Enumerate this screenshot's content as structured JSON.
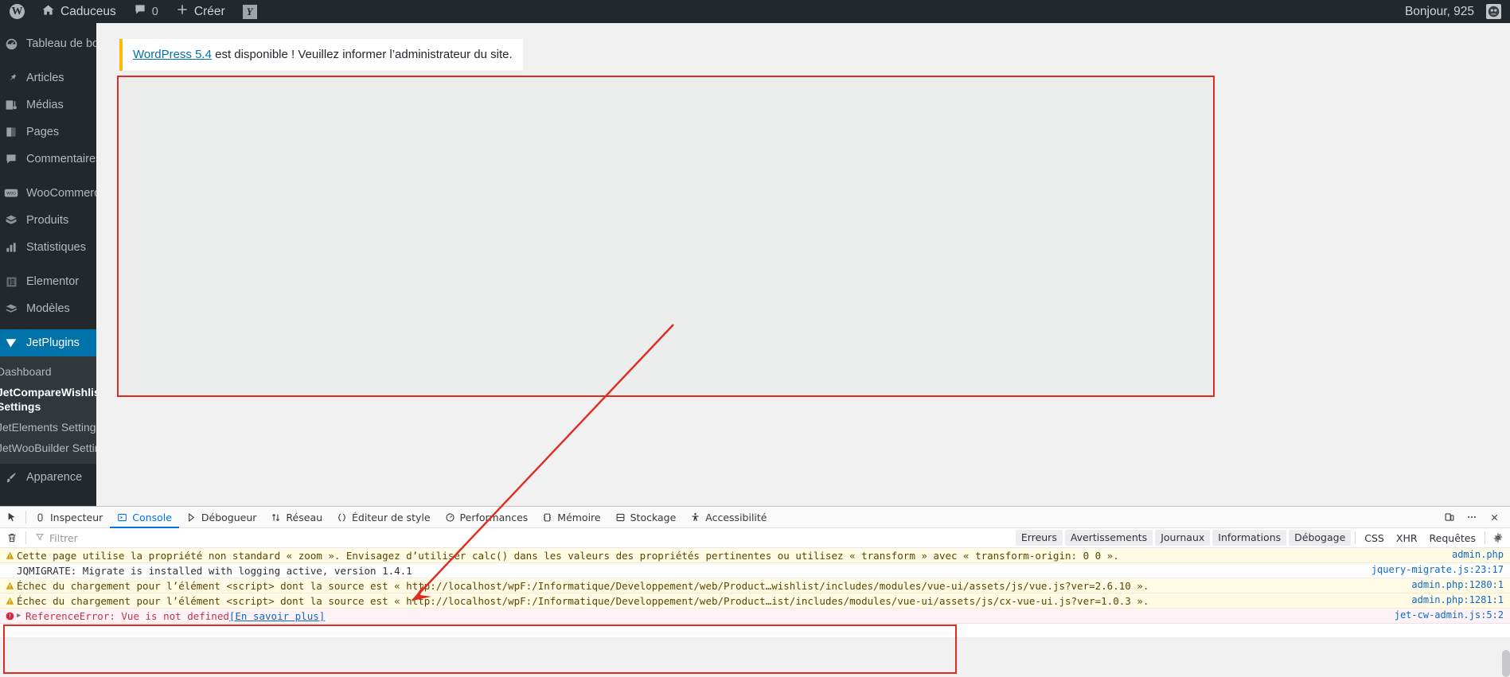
{
  "adminbar": {
    "logo_icon": "wordpress-logo-icon",
    "site_name": "Caduceus",
    "home_icon": "home-icon",
    "comments_icon": "comment-bubble-icon",
    "comments_count": "0",
    "new_icon": "plus-icon",
    "new_label": "Créer",
    "yoast_icon": "yoast-seo-icon",
    "howdy": "Bonjour, 925",
    "avatar_icon": "user-avatar-icon"
  },
  "sidebar": {
    "items": [
      {
        "label": "Tableau de bord",
        "icon": "dashboard-icon",
        "current": false
      },
      {
        "label": "Articles",
        "icon": "pin-icon",
        "current": false
      },
      {
        "label": "Médias",
        "icon": "media-icon",
        "current": false
      },
      {
        "label": "Pages",
        "icon": "page-icon",
        "current": false
      },
      {
        "label": "Commentaires",
        "icon": "comment-bubble-icon",
        "current": false
      },
      {
        "label": "WooCommerce",
        "icon": "woocommerce-icon",
        "current": false
      },
      {
        "label": "Produits",
        "icon": "box-icon",
        "current": false
      },
      {
        "label": "Statistiques",
        "icon": "bar-chart-icon",
        "current": false
      },
      {
        "label": "Elementor",
        "icon": "elementor-icon",
        "current": false
      },
      {
        "label": "Modèles",
        "icon": "template-icon",
        "current": false
      },
      {
        "label": "JetPlugins",
        "icon": "jetplugins-icon",
        "current": true
      }
    ],
    "submenu": [
      {
        "label": "Dashboard",
        "bold": false
      },
      {
        "label": "JetCompareWishlist Settings",
        "bold": true
      },
      {
        "label": "JetElements Settings",
        "bold": false
      },
      {
        "label": "JetWooBuilder Settings",
        "bold": false
      }
    ],
    "after_submenu": [
      {
        "label": "Apparence",
        "icon": "brush-icon",
        "current": false
      }
    ]
  },
  "content": {
    "notice": {
      "link_text": "WordPress 5.4",
      "rest_text": " est disponible ! Veuillez informer l’administrateur du site."
    }
  },
  "devtools": {
    "picker_icon": "element-picker-icon",
    "tabs": [
      {
        "label": "Inspecteur",
        "icon": "inspector-icon",
        "active": false
      },
      {
        "label": "Console",
        "icon": "console-icon",
        "active": true
      },
      {
        "label": "Débogueur",
        "icon": "debugger-icon",
        "active": false
      },
      {
        "label": "Réseau",
        "icon": "network-icon",
        "active": false
      },
      {
        "label": "Éditeur de style",
        "icon": "style-editor-icon",
        "active": false
      },
      {
        "label": "Performances",
        "icon": "performance-icon",
        "active": false
      },
      {
        "label": "Mémoire",
        "icon": "memory-icon",
        "active": false
      },
      {
        "label": "Stockage",
        "icon": "storage-icon",
        "active": false
      },
      {
        "label": "Accessibilité",
        "icon": "accessibility-icon",
        "active": false
      }
    ],
    "right_icons": [
      {
        "name": "responsive-design-mode-icon"
      },
      {
        "name": "meatball-menu-icon"
      },
      {
        "name": "close-icon"
      }
    ],
    "filterbar": {
      "trash_icon": "trash-icon",
      "filter_icon": "funnel-icon",
      "filter_placeholder": "Filtrer",
      "chips": [
        "Erreurs",
        "Avertissements",
        "Journaux",
        "Informations",
        "Débogage"
      ],
      "plain": [
        "CSS",
        "XHR",
        "Requêtes"
      ],
      "gear_icon": "gear-icon"
    },
    "logs": [
      {
        "level": "warn",
        "icon": "warning-triangle-icon",
        "text": "Cette page utilise la propriété non standard « zoom ». Envisagez d’utiliser calc() dans les valeurs des propriétés pertinentes ou utilisez « transform » avec « transform-origin: 0 0 ».",
        "source": "admin.php"
      },
      {
        "level": "log",
        "icon": "",
        "text": "JQMIGRATE: Migrate is installed with logging active, version 1.4.1",
        "source": "jquery-migrate.js:23:17"
      },
      {
        "level": "warn",
        "icon": "warning-triangle-icon",
        "text": "Échec du chargement pour l’élément <script> dont la source est « http://localhost/wpF:/Informatique/Developpement/web/Product…wishlist/includes/modules/vue-ui/assets/js/vue.js?ver=2.6.10 ».",
        "source": "admin.php:1280:1"
      },
      {
        "level": "warn",
        "icon": "warning-triangle-icon",
        "text": "Échec du chargement pour l’élément <script> dont la source est « http://localhost/wpF:/Informatique/Developpement/web/Product…ist/includes/modules/vue-ui/assets/js/cx-vue-ui.js?ver=1.0.3 ».",
        "source": "admin.php:1281:1"
      },
      {
        "level": "err",
        "icon": "error-circle-icon",
        "expand": "▶",
        "text": "ReferenceError: Vue is not defined ",
        "more_link": "[En savoir plus]",
        "source": "jet-cw-admin.js:5:2"
      }
    ]
  },
  "annotations": {
    "highlight_color": "#e02b20"
  }
}
